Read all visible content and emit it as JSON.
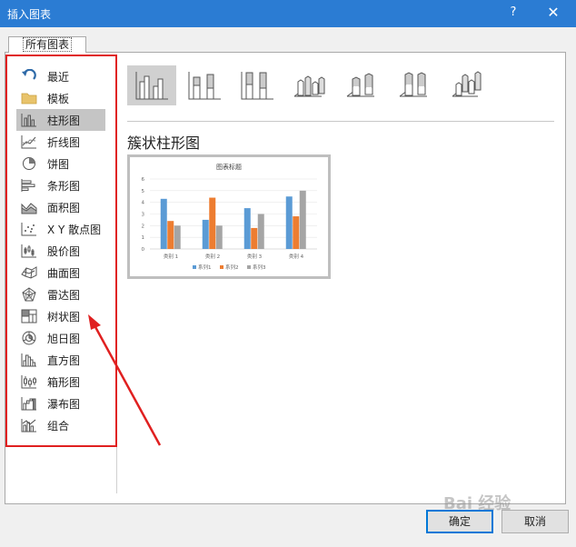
{
  "window": {
    "title": "插入图表",
    "help_glyph": "?",
    "close_glyph": "✕"
  },
  "tab": {
    "label": "所有图表"
  },
  "categories": [
    {
      "label": "最近",
      "icon": "recent-icon"
    },
    {
      "label": "模板",
      "icon": "folder-icon"
    },
    {
      "label": "柱形图",
      "icon": "column-chart-icon",
      "selected": true
    },
    {
      "label": "折线图",
      "icon": "line-chart-icon"
    },
    {
      "label": "饼图",
      "icon": "pie-chart-icon"
    },
    {
      "label": "条形图",
      "icon": "bar-chart-icon"
    },
    {
      "label": "面积图",
      "icon": "area-chart-icon"
    },
    {
      "label": "X Y 散点图",
      "icon": "scatter-chart-icon"
    },
    {
      "label": "股价图",
      "icon": "stock-chart-icon"
    },
    {
      "label": "曲面图",
      "icon": "surface-chart-icon"
    },
    {
      "label": "雷达图",
      "icon": "radar-chart-icon"
    },
    {
      "label": "树状图",
      "icon": "treemap-chart-icon"
    },
    {
      "label": "旭日图",
      "icon": "sunburst-chart-icon"
    },
    {
      "label": "直方图",
      "icon": "histogram-chart-icon"
    },
    {
      "label": "箱形图",
      "icon": "box-chart-icon"
    },
    {
      "label": "瀑布图",
      "icon": "waterfall-chart-icon"
    },
    {
      "label": "组合",
      "icon": "combo-chart-icon"
    }
  ],
  "selected_subtype_title": "簇状柱形图",
  "preview_chart": {
    "type": "bar",
    "title": "图表标题",
    "categories": [
      "类别 1",
      "类别 2",
      "类别 3",
      "类别 4"
    ],
    "series": [
      {
        "name": "系列1",
        "values": [
          4.3,
          2.5,
          3.5,
          4.5
        ],
        "color": "#5b9bd5"
      },
      {
        "name": "系列2",
        "values": [
          2.4,
          4.4,
          1.8,
          2.8
        ],
        "color": "#ed7d31"
      },
      {
        "name": "系列3",
        "values": [
          2,
          2,
          3,
          5
        ],
        "color": "#a5a5a5"
      }
    ],
    "yticks": [
      "0",
      "1",
      "2",
      "3",
      "4",
      "5",
      "6"
    ],
    "ylim": [
      0,
      6
    ]
  },
  "buttons": {
    "ok": "确定",
    "cancel": "取消"
  },
  "watermark": "Bai 经验"
}
